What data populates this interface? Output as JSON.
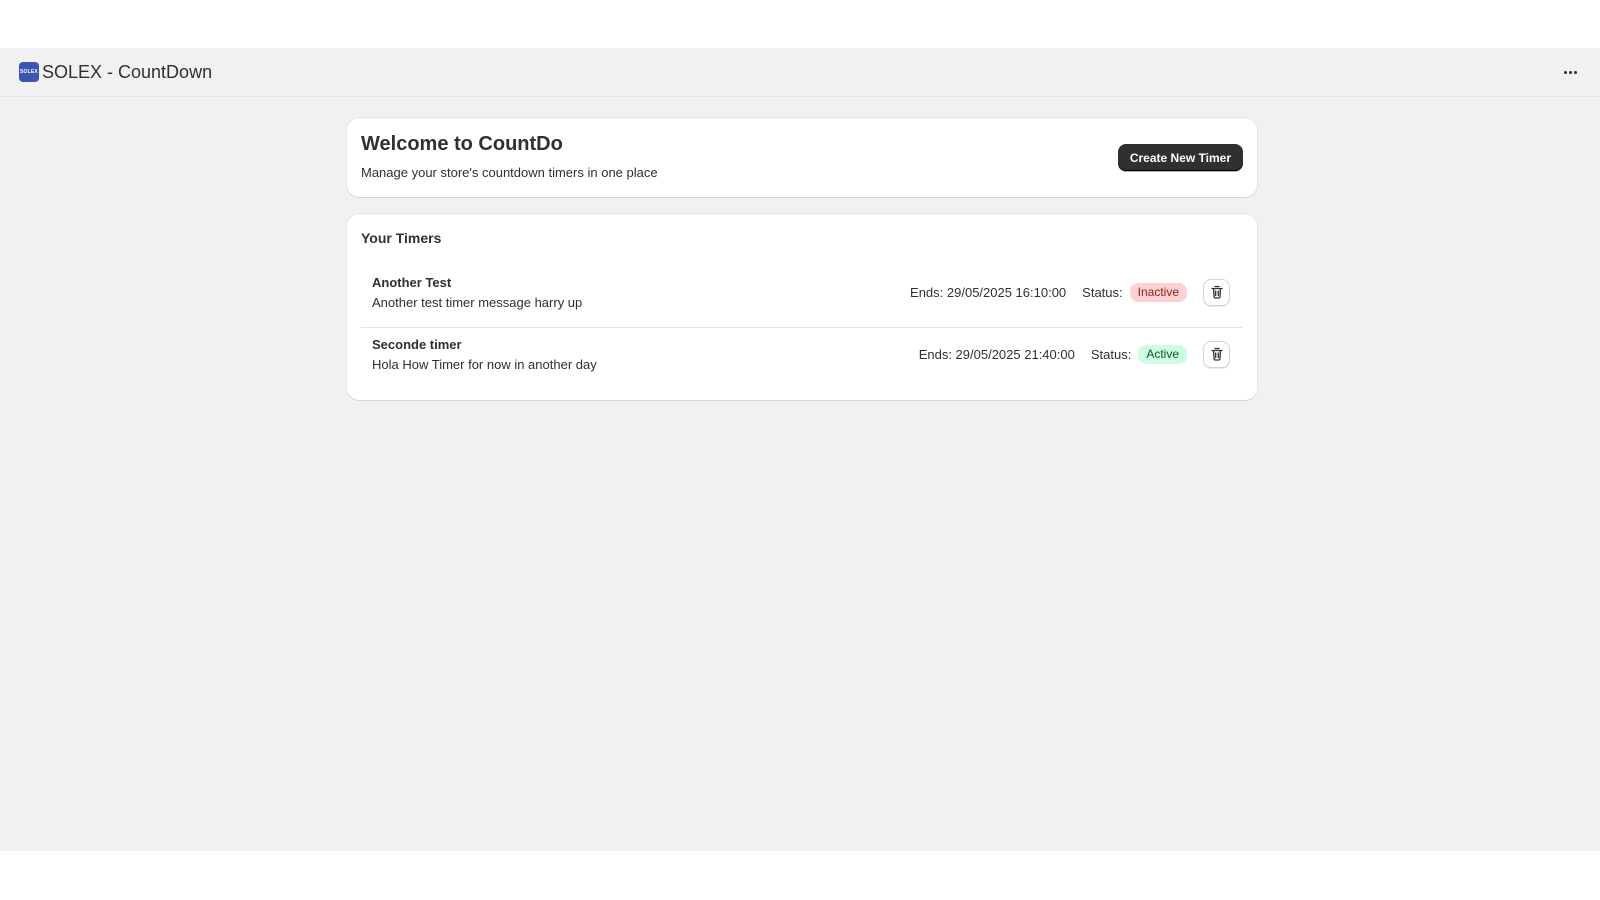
{
  "app": {
    "title": "SOLEX - CountDown",
    "logo_text": "SOLEX",
    "logo_color": "#3a55b4"
  },
  "welcome": {
    "title": "Welcome to CountDo",
    "subtitle": "Manage your store's countdown timers in one place",
    "create_button_label": "Create New Timer"
  },
  "timers": {
    "heading": "Your Timers",
    "status_label": "Status:",
    "items": [
      {
        "name": "Another Test",
        "message": "Another test timer message harry up",
        "ends": "Ends: 29/05/2025 16:10:00",
        "status": "Inactive",
        "status_color": "#fed1d7"
      },
      {
        "name": "Seconde timer",
        "message": "Hola How Timer for now in another day",
        "ends": "Ends: 29/05/2025 21:40:00",
        "status": "Active",
        "status_color": "#cdfee1"
      }
    ]
  },
  "icons": {
    "more": "more-horizontal-icon",
    "delete": "trash-icon"
  }
}
